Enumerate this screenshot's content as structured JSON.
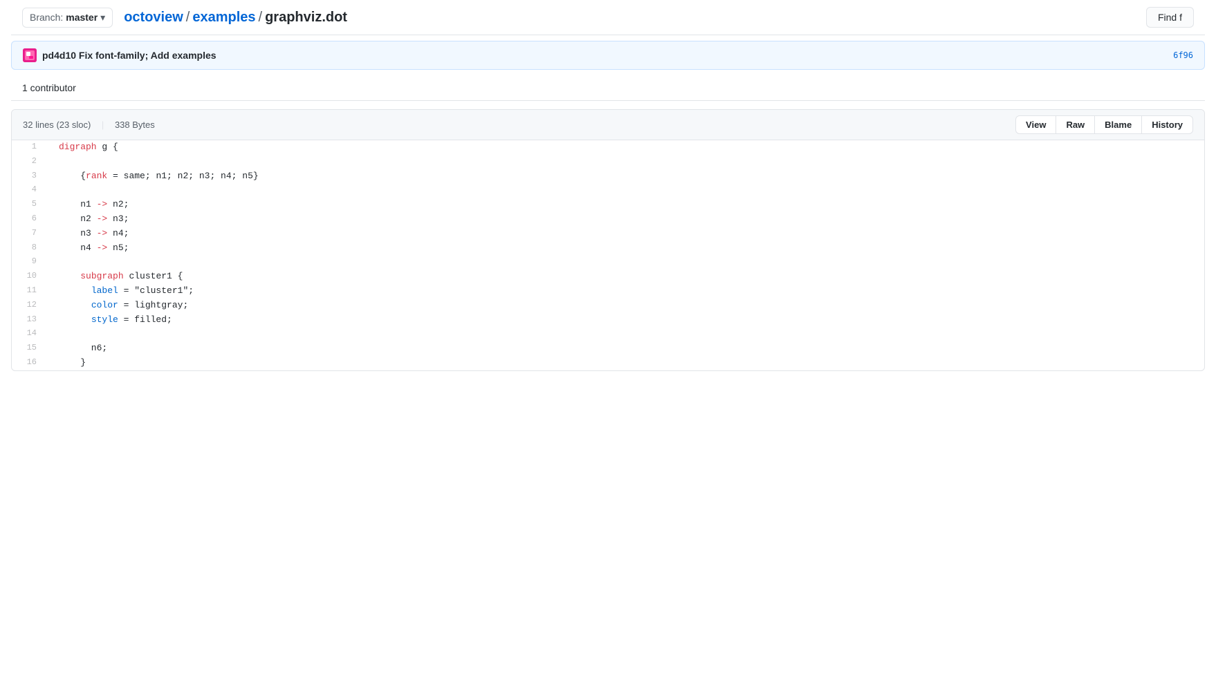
{
  "topBar": {
    "branch": {
      "label": "Branch:",
      "name": "master",
      "chevron": "▾"
    },
    "breadcrumb": {
      "repo": "octoview",
      "separator1": "/",
      "folder": "examples",
      "separator2": "/",
      "filename": "graphviz.dot"
    },
    "findFileBtn": "Find f"
  },
  "commitBar": {
    "authorAbbr": "pd4d10",
    "message": "Fix font-family; Add examples",
    "hash": "6f96"
  },
  "contributorBar": {
    "text": "1 contributor"
  },
  "fileHeader": {
    "lines": "32 lines",
    "sloc": "(23 sloc)",
    "bytes": "338 Bytes",
    "buttons": [
      "View",
      "Raw",
      "Blame",
      "History"
    ],
    "activeBtn": "View"
  },
  "codeLines": [
    {
      "num": "1",
      "tokens": [
        {
          "text": "digraph",
          "cls": "kw-red"
        },
        {
          "text": " g {",
          "cls": "normal"
        }
      ]
    },
    {
      "num": "2",
      "tokens": []
    },
    {
      "num": "3",
      "tokens": [
        {
          "text": "    {",
          "cls": "normal"
        },
        {
          "text": "rank",
          "cls": "kw-red"
        },
        {
          "text": " = same; n1; n2; n3; n4; n5}",
          "cls": "normal"
        }
      ]
    },
    {
      "num": "4",
      "tokens": []
    },
    {
      "num": "5",
      "tokens": [
        {
          "text": "    n1 ",
          "cls": "normal"
        },
        {
          "text": "->",
          "cls": "kw-red"
        },
        {
          "text": " n2;",
          "cls": "normal"
        }
      ]
    },
    {
      "num": "6",
      "tokens": [
        {
          "text": "    n2 ",
          "cls": "normal"
        },
        {
          "text": "->",
          "cls": "kw-red"
        },
        {
          "text": " n3;",
          "cls": "normal"
        }
      ]
    },
    {
      "num": "7",
      "tokens": [
        {
          "text": "    n3 ",
          "cls": "normal"
        },
        {
          "text": "->",
          "cls": "kw-red"
        },
        {
          "text": " n4;",
          "cls": "normal"
        }
      ]
    },
    {
      "num": "8",
      "tokens": [
        {
          "text": "    n4 ",
          "cls": "normal"
        },
        {
          "text": "->",
          "cls": "kw-red"
        },
        {
          "text": " n5;",
          "cls": "normal"
        }
      ]
    },
    {
      "num": "9",
      "tokens": []
    },
    {
      "num": "10",
      "tokens": [
        {
          "text": "    ",
          "cls": "normal"
        },
        {
          "text": "subgraph",
          "cls": "kw-red"
        },
        {
          "text": " cluster1 {",
          "cls": "normal"
        }
      ]
    },
    {
      "num": "11",
      "tokens": [
        {
          "text": "      ",
          "cls": "normal"
        },
        {
          "text": "label",
          "cls": "kw-blue"
        },
        {
          "text": " = \"cluster1\";",
          "cls": "normal"
        }
      ]
    },
    {
      "num": "12",
      "tokens": [
        {
          "text": "      ",
          "cls": "normal"
        },
        {
          "text": "color",
          "cls": "kw-blue"
        },
        {
          "text": " = lightgray;",
          "cls": "normal"
        }
      ]
    },
    {
      "num": "13",
      "tokens": [
        {
          "text": "      ",
          "cls": "normal"
        },
        {
          "text": "style",
          "cls": "kw-blue"
        },
        {
          "text": " = filled;",
          "cls": "normal"
        }
      ]
    },
    {
      "num": "14",
      "tokens": []
    },
    {
      "num": "15",
      "tokens": [
        {
          "text": "      n6;",
          "cls": "normal"
        }
      ]
    },
    {
      "num": "16",
      "tokens": [
        {
          "text": "    }",
          "cls": "normal"
        }
      ]
    }
  ],
  "colors": {
    "accent": "#0366d6",
    "keyword_red": "#d73a49",
    "keyword_blue": "#0066cc"
  }
}
